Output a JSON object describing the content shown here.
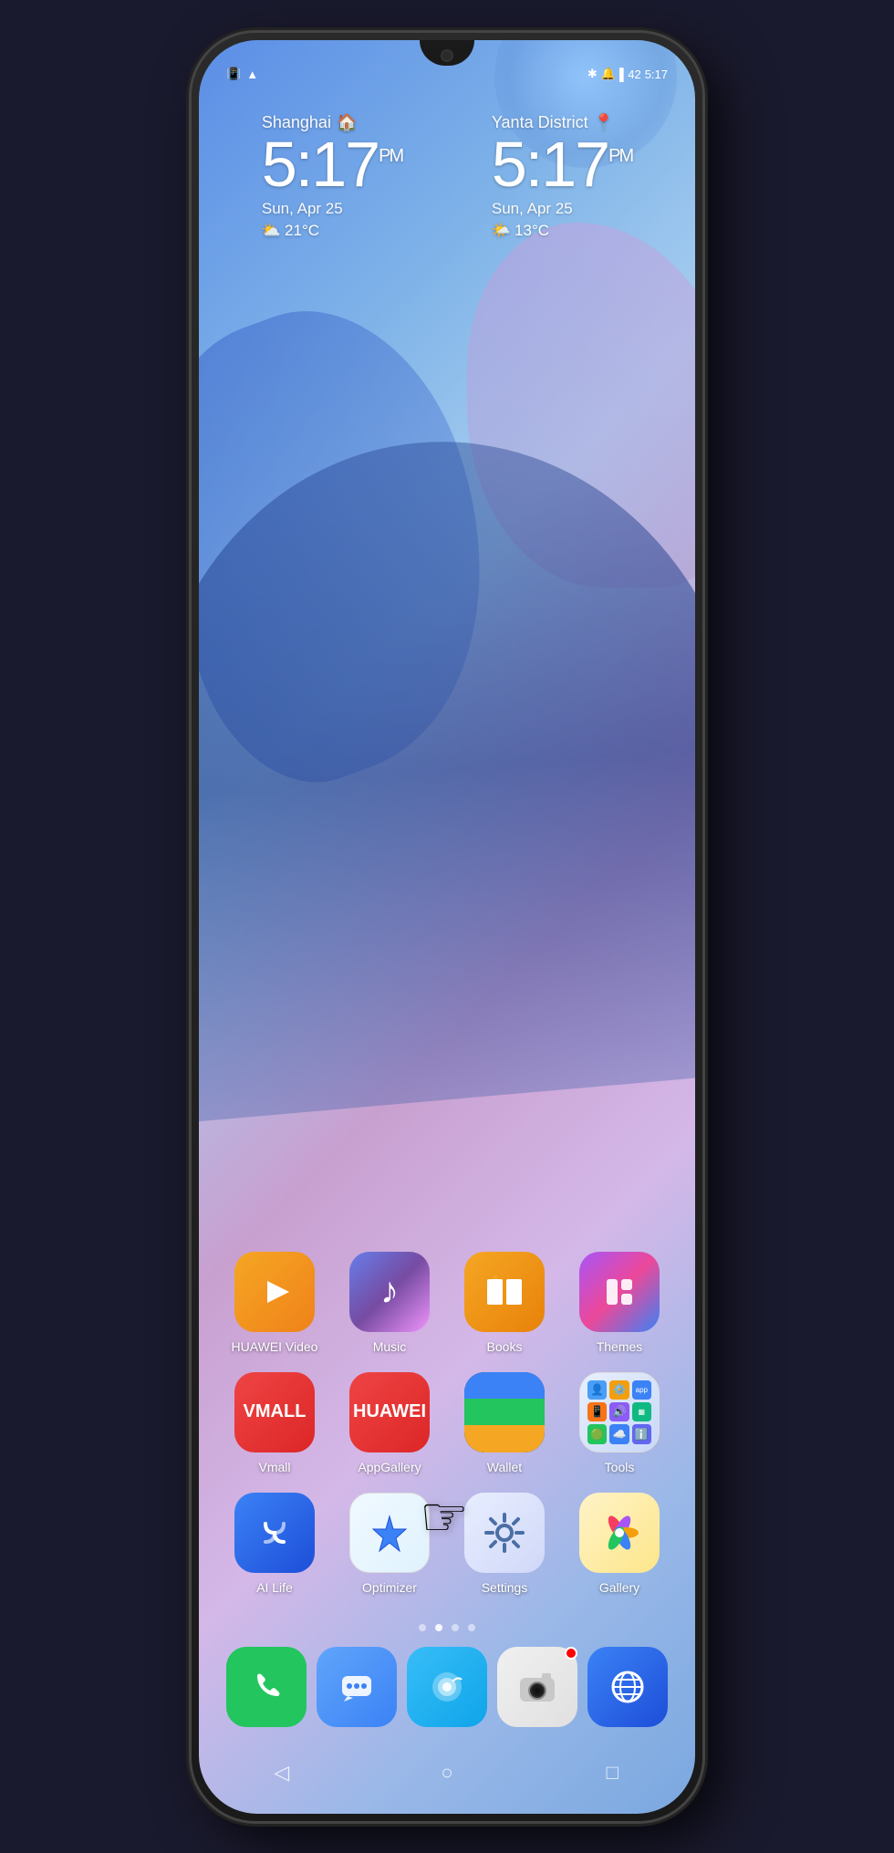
{
  "phone": {
    "status_bar": {
      "left_icons": [
        "sim-icon",
        "wifi-icon"
      ],
      "right_icons": [
        "bluetooth-icon",
        "mute-icon",
        "battery-icon",
        "time"
      ],
      "time": "5:17",
      "battery": "42"
    },
    "clock_widgets": [
      {
        "city": "Shanghai",
        "city_icon": "🏠",
        "time": "5:17",
        "period": "PM",
        "date": "Sun, Apr 25",
        "weather_icon": "⛅",
        "temperature": "21°C"
      },
      {
        "city": "Yanta District",
        "city_icon": "📍",
        "time": "5:17",
        "period": "PM",
        "date": "Sun, Apr 25",
        "weather_icon": "🌤️",
        "temperature": "13°C"
      }
    ],
    "app_rows": [
      [
        {
          "id": "huawei-video",
          "label": "HUAWEI Video",
          "icon_class": "icon-huawei-video"
        },
        {
          "id": "music",
          "label": "Music",
          "icon_class": "icon-music"
        },
        {
          "id": "books",
          "label": "Books",
          "icon_class": "icon-books"
        },
        {
          "id": "themes",
          "label": "Themes",
          "icon_class": "icon-themes"
        }
      ],
      [
        {
          "id": "vmall",
          "label": "Vmall",
          "icon_class": "icon-vmall"
        },
        {
          "id": "appgallery",
          "label": "AppGallery",
          "icon_class": "icon-appgallery"
        },
        {
          "id": "wallet",
          "label": "Wallet",
          "icon_class": "icon-wallet"
        },
        {
          "id": "tools",
          "label": "Tools",
          "icon_class": "icon-tools"
        }
      ],
      [
        {
          "id": "ai-life",
          "label": "AI Life",
          "icon_class": "icon-ai-life"
        },
        {
          "id": "optimizer",
          "label": "Optimizer",
          "icon_class": "icon-optimizer"
        },
        {
          "id": "settings",
          "label": "Settings",
          "icon_class": "icon-settings"
        },
        {
          "id": "gallery",
          "label": "Gallery",
          "icon_class": "icon-gallery"
        }
      ]
    ],
    "dock": [
      {
        "id": "phone",
        "icon_class": "icon-phone"
      },
      {
        "id": "messages",
        "icon_class": "icon-messages"
      },
      {
        "id": "support",
        "icon_class": "icon-support"
      },
      {
        "id": "camera",
        "icon_class": "icon-camera"
      },
      {
        "id": "browser",
        "icon_class": "icon-browser"
      }
    ],
    "nav": {
      "back": "◁",
      "home": "○",
      "recent": "□"
    },
    "dots": [
      false,
      true,
      false,
      false
    ]
  }
}
